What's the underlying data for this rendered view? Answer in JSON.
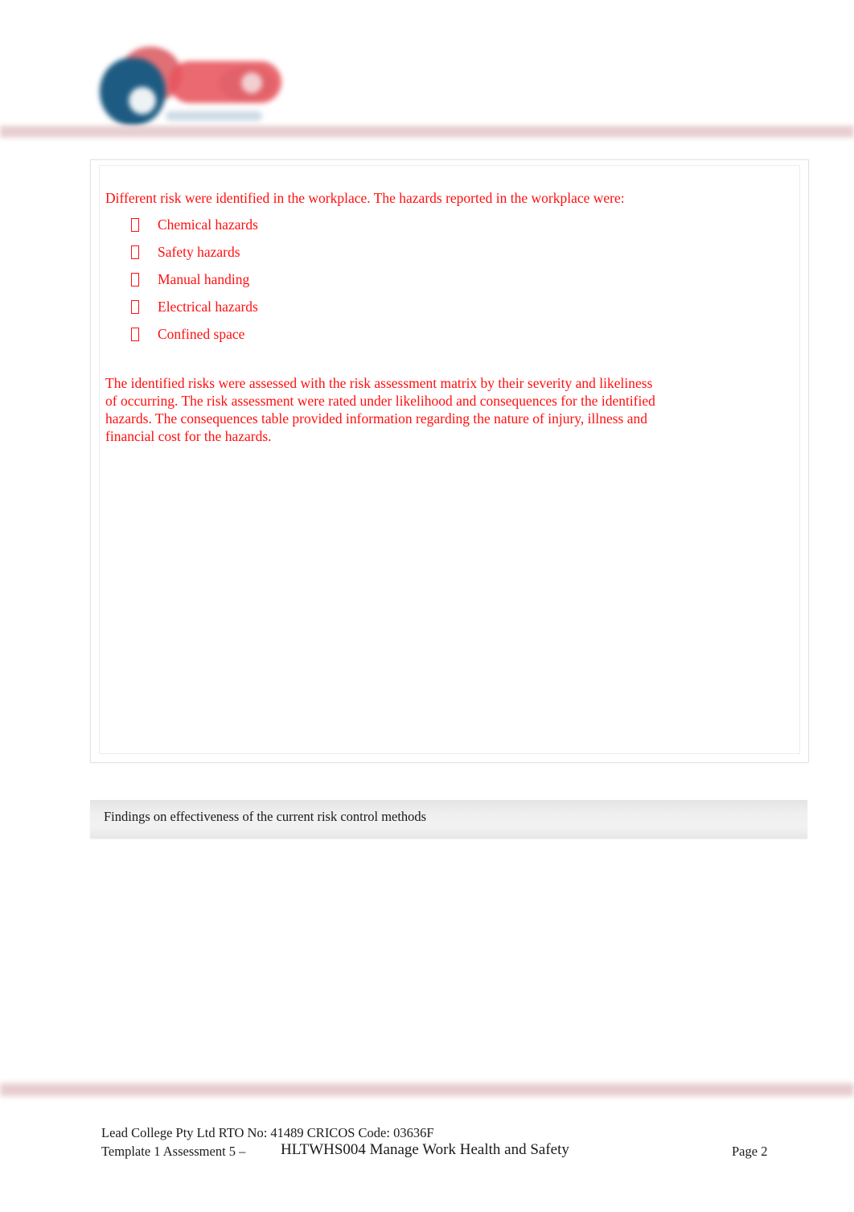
{
  "document": {
    "page_background": "#ffffff",
    "accent_rule_color": "#e6cbcd",
    "body_text_color": "#ff0f0f",
    "heading_bar_color": "#ededed"
  },
  "header": {
    "logo_name": "lead-college-logo",
    "logo_alt": "Lead College"
  },
  "answer_box": {
    "intro": "Different risk were identified in the workplace. The hazards reported in the workplace were:",
    "bullet_glyph": "",
    "hazards": [
      "Chemical hazards",
      "Safety hazards",
      "Manual handing",
      "Electrical hazards",
      "Confined space"
    ],
    "assessment_paragraph": "The identified risks were assessed with the risk assessment matrix by their severity and likeliness of occurring. The risk assessment were rated under likelihood and consequences for the identified hazards. The consequences table provided information regarding the nature of injury, illness and financial cost for the hazards."
  },
  "section_heading": {
    "label": "Findings on effectiveness of the current risk control methods"
  },
  "footer": {
    "line1": "Lead College Pty Ltd RTO No: 41489 CRICOS Code: 03636F",
    "template_label": "Template 1 Assessment 5 –",
    "unit_title": "HLTWHS004 Manage Work Health and Safety",
    "page_label": "Page 2"
  }
}
